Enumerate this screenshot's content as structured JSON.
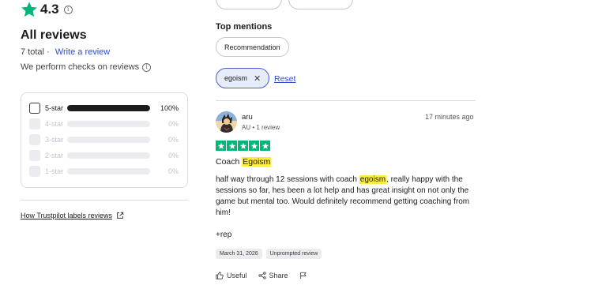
{
  "summary": {
    "rating": "4.3",
    "title": "All reviews",
    "total": "7 total",
    "write_review": "Write a review",
    "checks_text": "We perform checks on reviews",
    "labels_link": "How Trustpilot labels reviews"
  },
  "distribution": [
    {
      "label": "5-star",
      "percent": "100%",
      "fill": 1.0,
      "enabled": true
    },
    {
      "label": "4-star",
      "percent": "0%",
      "fill": 0,
      "enabled": false
    },
    {
      "label": "3-star",
      "percent": "0%",
      "fill": 0,
      "enabled": false
    },
    {
      "label": "2-star",
      "percent": "0%",
      "fill": 0,
      "enabled": false
    },
    {
      "label": "1-star",
      "percent": "0%",
      "fill": 0,
      "enabled": false
    }
  ],
  "filters": {
    "top_mentions_title": "Top mentions",
    "mention_recommendation": "Recommendation",
    "active_filter": "egoism",
    "reset": "Reset"
  },
  "review": {
    "name": "aru",
    "meta": "AU • 1 review",
    "time": "17 minutes ago",
    "stars": 5,
    "title_prefix": "Coach ",
    "title_highlight": "Egoism",
    "body_part1": "half way through 12 sessions with coach ",
    "body_highlight": "egoism",
    "body_part2": ", really happy with the sessions so far, hes been a lot help and has great insight on not only the game but mental too. Would definitely recommend getting coaching from him!",
    "extra": "+rep",
    "date_tag": "March 31, 2026",
    "type_tag": "Unprompted review",
    "useful": "Useful",
    "share": "Share"
  },
  "colors": {
    "trustpilot_green": "#00b67a",
    "link_blue": "#2e4bd0",
    "highlight": "#ffec3d"
  }
}
